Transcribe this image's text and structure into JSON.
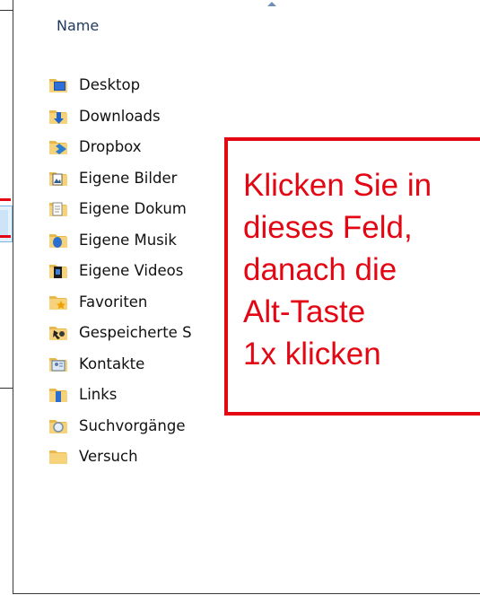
{
  "explorer": {
    "column_header": "Name",
    "sort_indicator": "sort-ascending-icon",
    "folders": [
      {
        "label": "Desktop",
        "icon": "desktop-folder-icon"
      },
      {
        "label": "Downloads",
        "icon": "downloads-folder-icon"
      },
      {
        "label": "Dropbox",
        "icon": "dropbox-folder-icon"
      },
      {
        "label": "Eigene Bilder",
        "icon": "pictures-folder-icon"
      },
      {
        "label": "Eigene Dokum",
        "icon": "documents-folder-icon"
      },
      {
        "label": "Eigene Musik",
        "icon": "music-folder-icon"
      },
      {
        "label": "Eigene Videos",
        "icon": "videos-folder-icon"
      },
      {
        "label": "Favoriten",
        "icon": "favorites-folder-icon"
      },
      {
        "label": "Gespeicherte S",
        "icon": "saved-games-folder-icon"
      },
      {
        "label": "Kontakte",
        "icon": "contacts-folder-icon"
      },
      {
        "label": "Links",
        "icon": "links-folder-icon"
      },
      {
        "label": "Suchvorgänge",
        "icon": "searches-folder-icon"
      },
      {
        "label": "Versuch",
        "icon": "folder-icon"
      }
    ]
  },
  "callout": {
    "lines": [
      "Klicken Sie in",
      "dieses Feld,",
      "danach die",
      "Alt-Taste",
      "1x klicken"
    ],
    "color": "#e30613"
  }
}
